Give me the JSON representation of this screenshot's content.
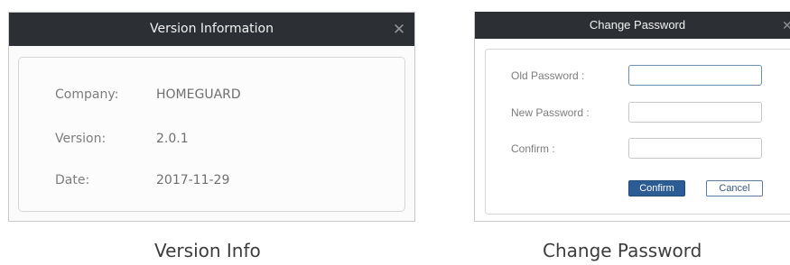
{
  "version_dialog": {
    "title": "Version Information",
    "close_glyph": "✕",
    "company_label": "Company:",
    "company_value": "HOMEGUARD",
    "version_label": "Version:",
    "version_value": "2.0.1",
    "date_label": "Date:",
    "date_value": "2017-11-29"
  },
  "password_dialog": {
    "title": "Change Password",
    "close_glyph": "✕",
    "old_password_label": "Old Password :",
    "old_password_value": "",
    "new_password_label": "New Password :",
    "new_password_value": "",
    "confirm_label": "Confirm :",
    "confirm_value": "",
    "confirm_button": "Confirm",
    "cancel_button": "Cancel"
  },
  "captions": {
    "left": "Version Info",
    "right": "Change Password"
  },
  "colors": {
    "titlebar": "#2c2f34",
    "primary_button": "#2b5c93",
    "label_text": "#7d7d7d"
  },
  "icons": {
    "close": "close-icon"
  }
}
